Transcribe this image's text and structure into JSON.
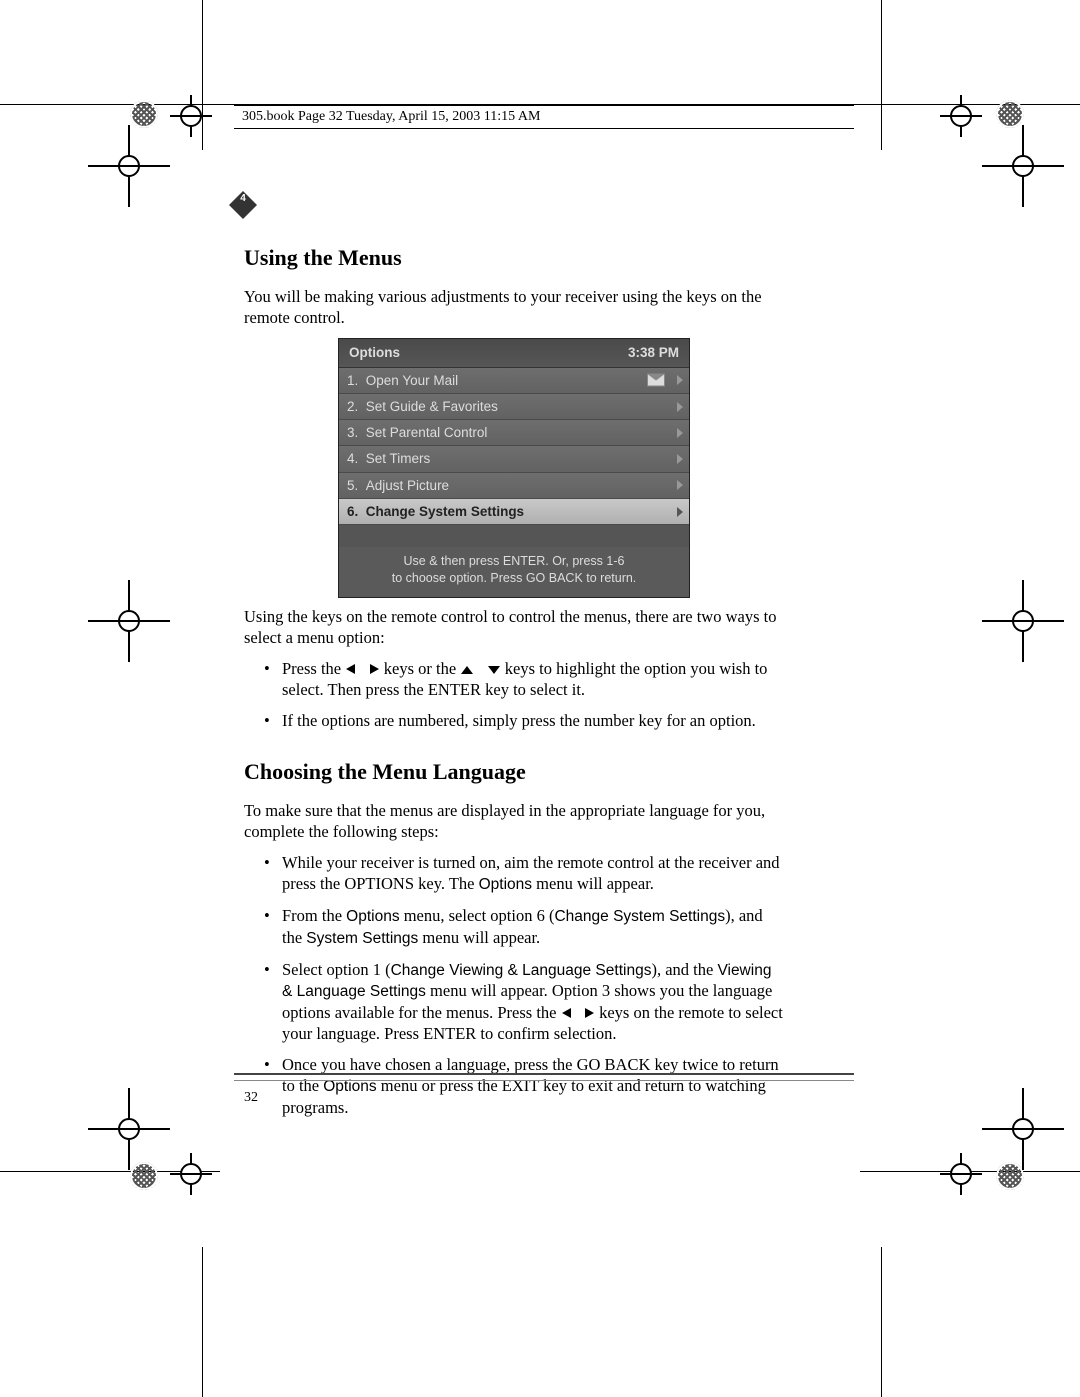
{
  "header": "305.book  Page 32  Tuesday, April 15, 2003  11:15 AM",
  "chapter_badge": "4",
  "page_number": "32",
  "section1": {
    "title": "Using the Menus",
    "p1": "You will be making various adjustments to your receiver using the keys on the remote control.",
    "p2": "Using the keys on the remote control to control the menus, there are two ways to select a menu option:",
    "bullet1a": "Press the ",
    "bullet1b": " keys or the ",
    "bullet1c": " keys to highlight the option you wish to select. Then press the ENTER key to select it.",
    "bullet2": "If the options are numbered, simply press the number key for an option."
  },
  "menu": {
    "title": "Options",
    "time": "3:38 PM",
    "items": [
      {
        "n": "1.",
        "label": "Open Your Mail",
        "mail": true
      },
      {
        "n": "2.",
        "label": "Set Guide & Favorites"
      },
      {
        "n": "3.",
        "label": "Set Parental Control"
      },
      {
        "n": "4.",
        "label": "Set Timers"
      },
      {
        "n": "5.",
        "label": "Adjust Picture"
      },
      {
        "n": "6.",
        "label": "Change System Settings",
        "selected": true
      }
    ],
    "hint1": "Use    & then press ENTER.  Or, press 1-6",
    "hint2": "to choose option.  Press GO BACK to return."
  },
  "section2": {
    "title": "Choosing the Menu Language",
    "p1": "To make sure that the menus are displayed in the appropriate language for you, complete the following steps:",
    "b1a": "While your receiver is turned on, aim the remote control at the receiver and press the OPTIONS key. The ",
    "b1b": "Options",
    "b1c": " menu will appear.",
    "b2a": "From the ",
    "b2b": "Options",
    "b2c": " menu, select option 6 (",
    "b2d": "Change System Settings",
    "b2e": "), and the ",
    "b2f": "System Settings",
    "b2g": " menu will appear.",
    "b3a": "Select option 1 (",
    "b3b": "Change Viewing & Language Settings",
    "b3c": "), and the ",
    "b3d": "Viewing & Language Settings",
    "b3e": " menu will appear. Option 3 shows you the language options available for the menus. Press the ",
    "b3f": " keys on the remote to select your language. Press ENTER to confirm selection.",
    "b4a": "Once you have chosen a language, press the GO BACK key twice to return to the ",
    "b4b": "Options",
    "b4c": " menu or press the EXIT key to exit and return to watching programs."
  }
}
